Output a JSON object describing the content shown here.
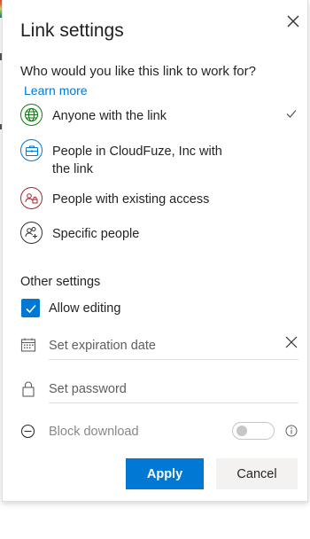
{
  "dialog": {
    "title": "Link settings",
    "question": "Who would you like this link to work for?",
    "learn_more": "Learn more"
  },
  "audience_options": [
    {
      "label": "Anyone with the link",
      "icon": "globe-icon",
      "color": "#107c10",
      "selected": true
    },
    {
      "label": "People in CloudFuze, Inc with the link",
      "icon": "briefcase-icon",
      "color": "#0078d4",
      "selected": false
    },
    {
      "label": "People with existing access",
      "icon": "people-lock-icon",
      "color": "#a4262c",
      "selected": false
    },
    {
      "label": "Specific people",
      "icon": "people-add-icon",
      "color": "#323130",
      "selected": false
    }
  ],
  "other_settings": {
    "label": "Other settings",
    "allow_editing": {
      "label": "Allow editing",
      "checked": true
    },
    "expiration": {
      "placeholder": "Set expiration date",
      "value": ""
    },
    "password": {
      "placeholder": "Set password",
      "value": ""
    },
    "block_download": {
      "label": "Block download",
      "enabled": false
    }
  },
  "buttons": {
    "apply": "Apply",
    "cancel": "Cancel"
  },
  "colors": {
    "accent": "#0078d4",
    "text": "#252423",
    "muted": "#605e5c"
  }
}
